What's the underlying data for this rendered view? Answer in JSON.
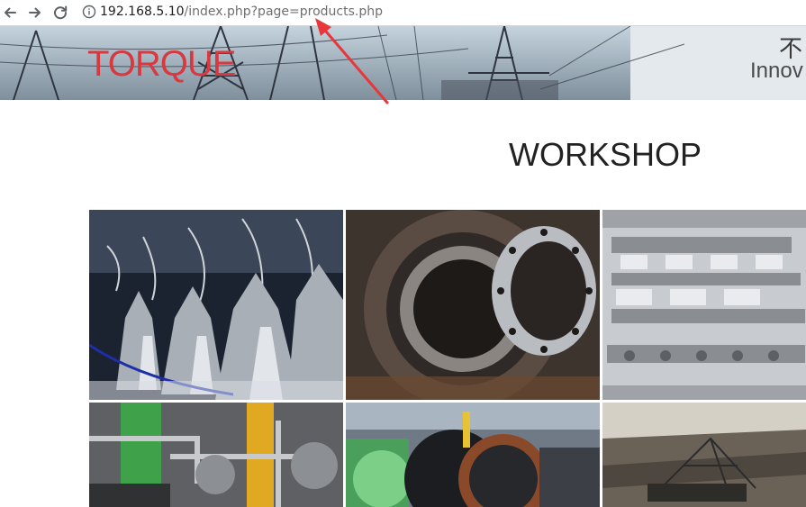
{
  "browser": {
    "nav_icons": [
      "arrow-back-icon",
      "arrow-forward-icon",
      "reload-icon"
    ],
    "address_bar": {
      "icon": "info-icon",
      "host": "192.168.5.10",
      "path": "/index.php?page=products.php"
    }
  },
  "banner": {
    "brand": "TORQUE",
    "brand_color": "#d9383f",
    "right_char": "不",
    "right_text": "Innov"
  },
  "annotation": {
    "type": "arrow",
    "color": "#e8363a"
  },
  "page": {
    "heading": "WORKSHOP"
  },
  "gallery": {
    "items": [
      {
        "subject": "rocket engine assembly line"
      },
      {
        "subject": "large gear ring component"
      },
      {
        "subject": "aluminium cylinder head casting"
      },
      {
        "subject": "industrial machinery with green and yellow parts"
      },
      {
        "subject": "heavy turbine rotor in factory"
      },
      {
        "subject": "mining excavator in open pit"
      }
    ]
  }
}
